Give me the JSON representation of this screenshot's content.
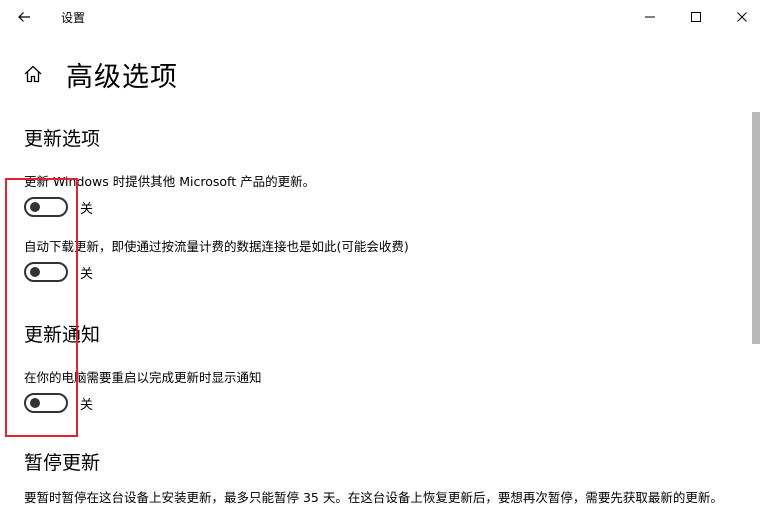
{
  "window": {
    "title": "设置"
  },
  "page": {
    "title": "高级选项"
  },
  "update_options": {
    "heading": "更新选项",
    "items": [
      {
        "label": "更新 Windows 时提供其他 Microsoft 产品的更新。",
        "state": "关"
      },
      {
        "label": "自动下载更新，即使通过按流量计费的数据连接也是如此(可能会收费)",
        "state": "关"
      }
    ]
  },
  "update_notifications": {
    "heading": "更新通知",
    "items": [
      {
        "label": "在你的电脑需要重启以完成更新时显示通知",
        "state": "关"
      }
    ]
  },
  "pause_updates": {
    "heading": "暂停更新",
    "description": "要暂时暂停在这台设备上安装更新，最多只能暂停 35 天。在这台设备上恢复更新后，要想再次暂停，需要先获取最新的更新。"
  },
  "colors": {
    "highlight": "#e0232e",
    "toggle_off": "#333333",
    "scrollbar": "#b9b9b9"
  },
  "icons": {
    "back": "back-arrow-icon",
    "home": "home-icon",
    "minimize": "minimize-icon",
    "maximize": "maximize-icon",
    "close": "close-icon"
  }
}
